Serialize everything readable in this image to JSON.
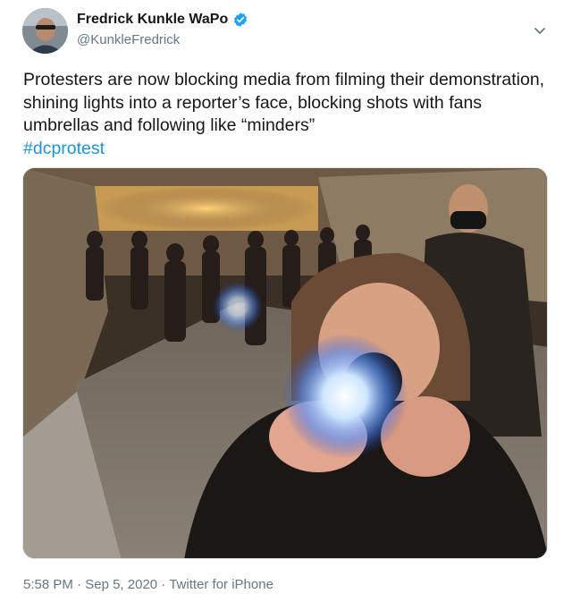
{
  "author": {
    "display_name": "Fredrick Kunkle WaPo",
    "handle": "@KunkleFredrick",
    "verified_icon": "verified-badge-icon",
    "avatar_icon": "profile-avatar"
  },
  "menu_icon": "chevron-down-icon",
  "tweet": {
    "text": "Protesters are now blocking media from filming their demonstration, shining lights into a reporter’s face, blocking shots with fans umbrellas and following like “minders”",
    "hashtag": "#dcprotest"
  },
  "media": {
    "subject": "photo-night-protest-flashlight"
  },
  "meta": {
    "time": "5:58 PM",
    "separator": "·",
    "date": "Sep 5, 2020",
    "source": "Twitter for iPhone"
  },
  "colors": {
    "text": "#14171a",
    "secondary": "#657786",
    "link": "#1b95e0",
    "verified": "#1da1f2"
  }
}
